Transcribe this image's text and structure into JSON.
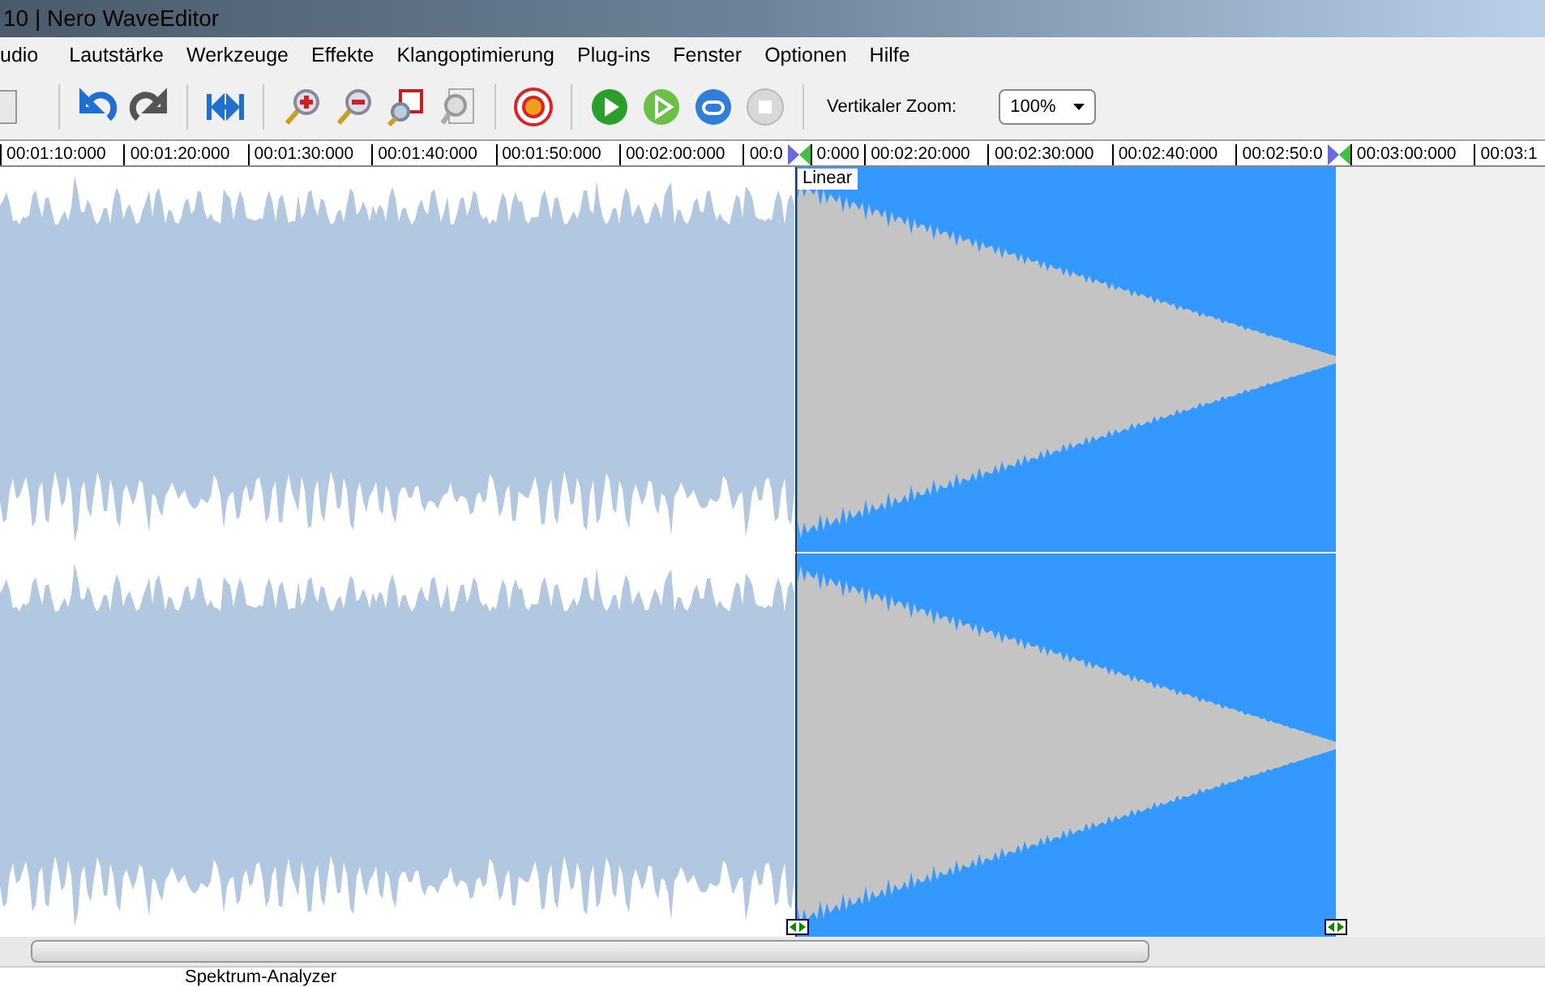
{
  "window": {
    "title": "10 | Nero WaveEditor"
  },
  "menu": [
    {
      "label": "udio"
    },
    {
      "label": "Lautstärke"
    },
    {
      "label": "Werkzeuge"
    },
    {
      "label": "Effekte"
    },
    {
      "label": "Klangoptimierung"
    },
    {
      "label": "Plug-ins"
    },
    {
      "label": "Fenster"
    },
    {
      "label": "Optionen"
    },
    {
      "label": "Hilfe"
    }
  ],
  "toolbar": {
    "zoom_label": "Vertikaler Zoom:",
    "zoom_value": "100%"
  },
  "ruler": [
    {
      "kind": "label",
      "text": "00:01:10:000"
    },
    {
      "kind": "label",
      "text": "00:01:20:000"
    },
    {
      "kind": "label",
      "text": "00:01:30:000"
    },
    {
      "kind": "label",
      "text": "00:01:40:000"
    },
    {
      "kind": "label",
      "text": "00:01:50:000"
    },
    {
      "kind": "label",
      "text": "00:02:00:000"
    },
    {
      "kind": "partial",
      "text": "00:0"
    },
    {
      "kind": "marker"
    },
    {
      "kind": "partial",
      "text": "0:000"
    },
    {
      "kind": "label",
      "text": "00:02:20:000"
    },
    {
      "kind": "label",
      "text": "00:02:30:000"
    },
    {
      "kind": "label",
      "text": "00:02:40:000"
    },
    {
      "kind": "partial",
      "text": "00:02:50:0"
    },
    {
      "kind": "marker"
    },
    {
      "kind": "label",
      "text": "00:03:00:000"
    },
    {
      "kind": "partial",
      "text": "00:03:1"
    }
  ],
  "selection": {
    "fade_label": "Linear"
  },
  "bottom_tab": {
    "label": "Spektrum-Analyzer"
  }
}
